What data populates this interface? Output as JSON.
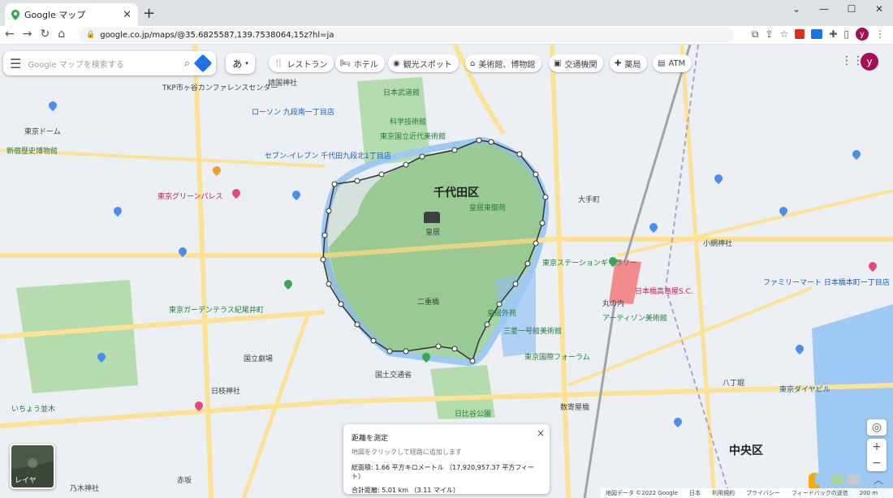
{
  "tab": {
    "title": "Google マップ"
  },
  "address": {
    "url": "google.co.jp/maps/@35.6825587,139.7538064,15z?hl=ja"
  },
  "search": {
    "placeholder": "Google マップを検索する"
  },
  "lang_button": {
    "label": "あ"
  },
  "chips": [
    {
      "label": "レストラン",
      "icon": "fork-knife-icon"
    },
    {
      "label": "ホテル",
      "icon": "bed-icon"
    },
    {
      "label": "観光スポット",
      "icon": "camera-icon"
    },
    {
      "label": "美術館、博物館",
      "icon": "museum-icon"
    },
    {
      "label": "交通機関",
      "icon": "train-icon"
    },
    {
      "label": "薬局",
      "icon": "pharmacy-icon"
    },
    {
      "label": "ATM",
      "icon": "atm-icon"
    }
  ],
  "profile": {
    "initial": "y"
  },
  "map": {
    "wards": [
      "千代田区",
      "中央区"
    ],
    "palace": {
      "name": "皇居"
    },
    "labels": [
      "皇居東御苑",
      "二重橋",
      "日比谷公園",
      "東京ステーションギャラリー",
      "アーティゾン美術館",
      "日本橋高島屋S.C.",
      "東京ドーム",
      "日本武道館",
      "科学技術館",
      "東京国立近代美術館",
      "国立劇場",
      "東京グリーンパレス",
      "赤坂",
      "いちょう並木",
      "大手町",
      "丸の内",
      "三菱一号館美術館",
      "日枝神社",
      "乃木神社",
      "八丁堀",
      "東京ダイヤビル",
      "セブン-イレブン 千代田九段北1丁目店",
      "ローソン 九段南一丁目店",
      "ファミリーマート 日本橋本町一丁目店",
      "靖国神社",
      "小網神社",
      "東京ガーデンテラス紀尾井町",
      "皇居外苑",
      "東京国際フォーラム",
      "国土交通省",
      "数寄屋橋",
      "新宿歴史博物館",
      "TKP市ヶ谷カンファレンスセンター"
    ]
  },
  "measure": {
    "title": "距離を測定",
    "hint": "地図をクリックして経路に追加します",
    "area": "総面積: 1.66 平方キロメートル （17,920,957.37 平方フィート）",
    "distance": "合計距離: 5.01 km （3.11 マイル）",
    "close": "×"
  },
  "layer": {
    "label": "レイヤ"
  },
  "footer": [
    "地図データ ©2022 Google",
    "日本",
    "利用規約",
    "プライバシー",
    "フィードバックの送信",
    "200 m"
  ],
  "colors": {
    "park": "#a8d5a2",
    "water": "#9fc9f5",
    "road": "#fde293",
    "accent": "#1a73e8"
  }
}
